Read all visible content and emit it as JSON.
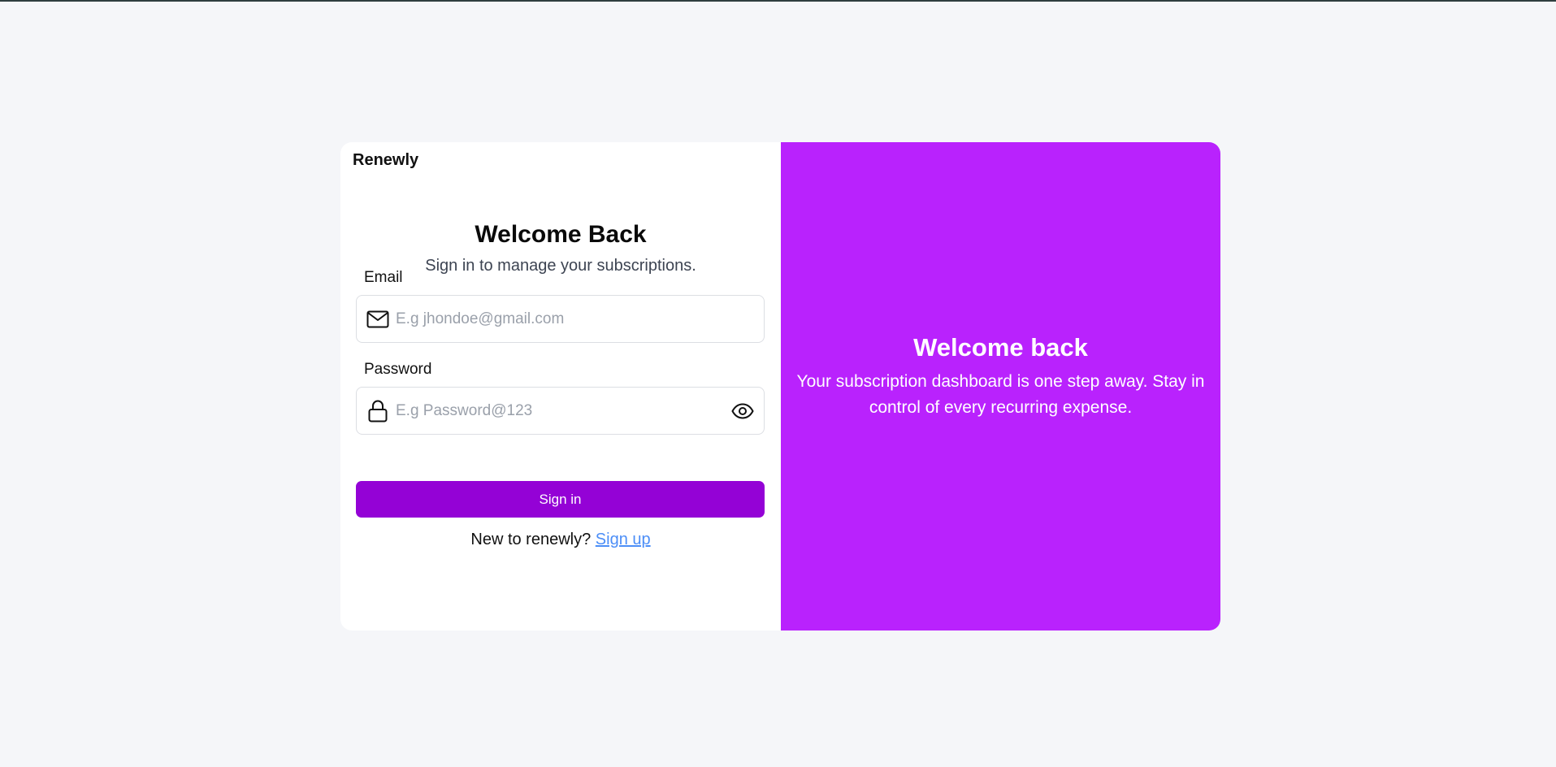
{
  "brand": "Renewly",
  "login": {
    "title": "Welcome Back",
    "subtitle": "Sign in to manage your subscriptions.",
    "email": {
      "label": "Email",
      "placeholder": "E.g jhondoe@gmail.com",
      "value": "",
      "icon": "mail-icon"
    },
    "password": {
      "label": "Password",
      "placeholder": "E.g Password@123",
      "value": "",
      "icon": "lock-icon",
      "toggle_icon": "eye-icon"
    },
    "submit_label": "Sign in",
    "signup_prompt": "New to renewly?",
    "signup_link": "Sign up"
  },
  "promo": {
    "title": "Welcome back",
    "text": "Your subscription dashboard is one step away. Stay in control of every recurring expense."
  },
  "colors": {
    "background": "#f5f6f9",
    "promo_panel": "#b922fd",
    "primary_button": "#9402d6",
    "link": "#4c8ef7"
  }
}
